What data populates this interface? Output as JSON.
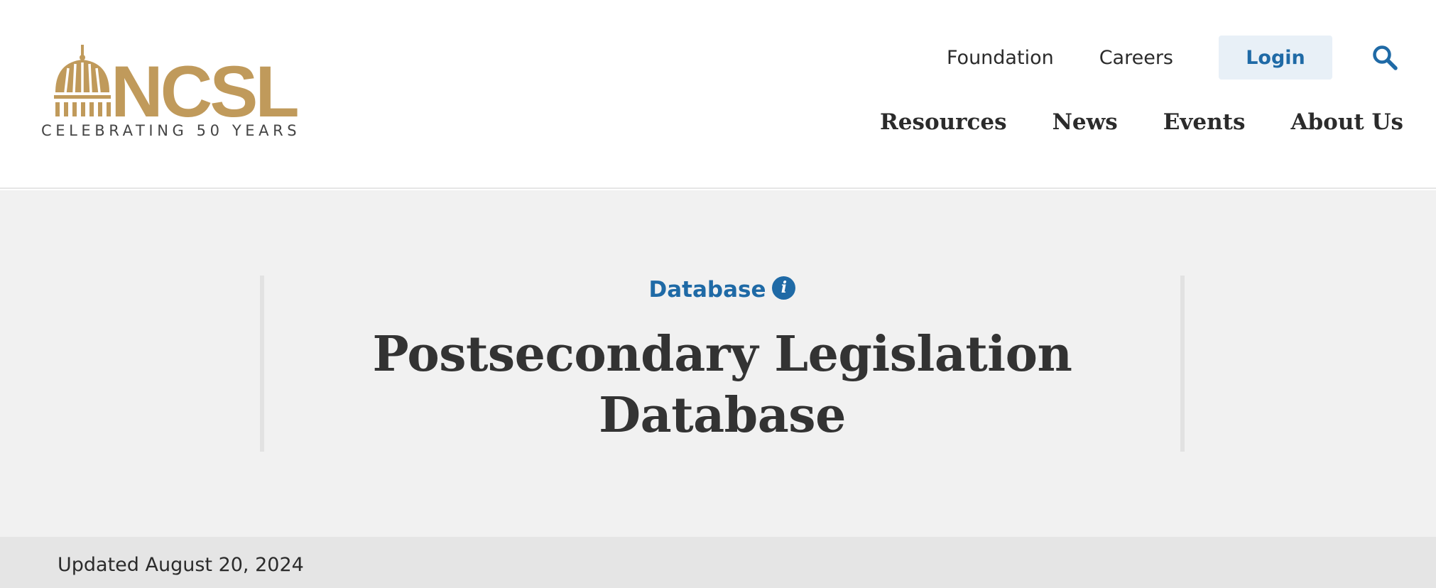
{
  "logo": {
    "wordmark": "NCSL",
    "tagline": "CELEBRATING 50 YEARS",
    "brand_color": "#c09a5b"
  },
  "utility_nav": {
    "links": [
      {
        "label": "Foundation"
      },
      {
        "label": "Careers"
      }
    ],
    "login_label": "Login",
    "search_icon": "search-icon"
  },
  "main_nav": {
    "items": [
      {
        "label": "Resources"
      },
      {
        "label": "News"
      },
      {
        "label": "Events"
      },
      {
        "label": "About Us"
      }
    ]
  },
  "hero": {
    "content_type": "Database",
    "info_icon": "info-icon",
    "title_line_1": "Postsecondary Legislation",
    "title_line_2": "Database"
  },
  "meta": {
    "updated": "Updated August 20, 2024"
  },
  "colors": {
    "accent_blue": "#1f6aa6",
    "login_bg": "#e8f0f7",
    "hero_bg": "#f1f1f1",
    "updated_bar_bg": "#e5e5e5",
    "text": "#2b2b2b"
  }
}
